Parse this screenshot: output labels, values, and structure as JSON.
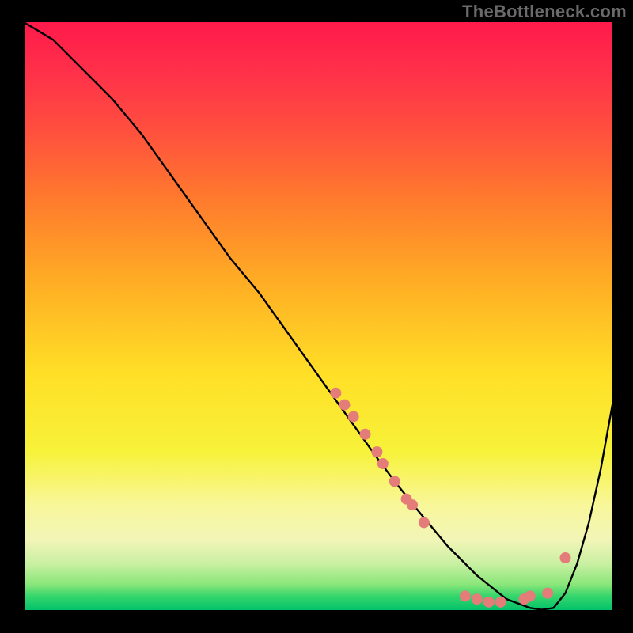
{
  "watermark": "TheBottleneck.com",
  "chart_data": {
    "type": "line",
    "title": "",
    "xlabel": "",
    "ylabel": "",
    "xlim": [
      0,
      100
    ],
    "ylim": [
      0,
      100
    ],
    "background_gradient": [
      {
        "pos": 0.0,
        "color": "#ff1a4b"
      },
      {
        "pos": 0.08,
        "color": "#ff2f4a"
      },
      {
        "pos": 0.18,
        "color": "#ff4e3f"
      },
      {
        "pos": 0.3,
        "color": "#ff7a2d"
      },
      {
        "pos": 0.45,
        "color": "#ffb024"
      },
      {
        "pos": 0.6,
        "color": "#ffe027"
      },
      {
        "pos": 0.73,
        "color": "#f7f23a"
      },
      {
        "pos": 0.82,
        "color": "#f8f79a"
      },
      {
        "pos": 0.88,
        "color": "#f1f5b7"
      },
      {
        "pos": 0.92,
        "color": "#c9f0a2"
      },
      {
        "pos": 0.955,
        "color": "#8ae67a"
      },
      {
        "pos": 0.975,
        "color": "#35d66c"
      },
      {
        "pos": 1.0,
        "color": "#00c16a"
      }
    ],
    "curve": {
      "x": [
        0,
        5,
        10,
        15,
        20,
        25,
        30,
        35,
        40,
        45,
        50,
        55,
        60,
        63,
        67,
        72,
        77,
        82,
        86,
        88,
        90,
        92,
        94,
        96,
        98,
        100
      ],
      "y": [
        100,
        97,
        92,
        87,
        81,
        74,
        67,
        60,
        54,
        47,
        40,
        33,
        26,
        22,
        17,
        11,
        6,
        2,
        0.5,
        0.2,
        0.5,
        3,
        8,
        15,
        24,
        35
      ]
    },
    "markers": [
      {
        "x": 53,
        "y": 37
      },
      {
        "x": 54.5,
        "y": 35
      },
      {
        "x": 56,
        "y": 33
      },
      {
        "x": 58,
        "y": 30
      },
      {
        "x": 60,
        "y": 27
      },
      {
        "x": 61,
        "y": 25
      },
      {
        "x": 63,
        "y": 22
      },
      {
        "x": 65,
        "y": 19
      },
      {
        "x": 66,
        "y": 18
      },
      {
        "x": 68,
        "y": 15
      },
      {
        "x": 75,
        "y": 2.5
      },
      {
        "x": 77,
        "y": 2
      },
      {
        "x": 79,
        "y": 1.5
      },
      {
        "x": 81,
        "y": 1.5
      },
      {
        "x": 85,
        "y": 2
      },
      {
        "x": 86,
        "y": 2.5
      },
      {
        "x": 89,
        "y": 3
      },
      {
        "x": 92,
        "y": 9
      }
    ],
    "marker_color": "#e47c79",
    "curve_color": "#000000",
    "axis_color": "#000000"
  }
}
